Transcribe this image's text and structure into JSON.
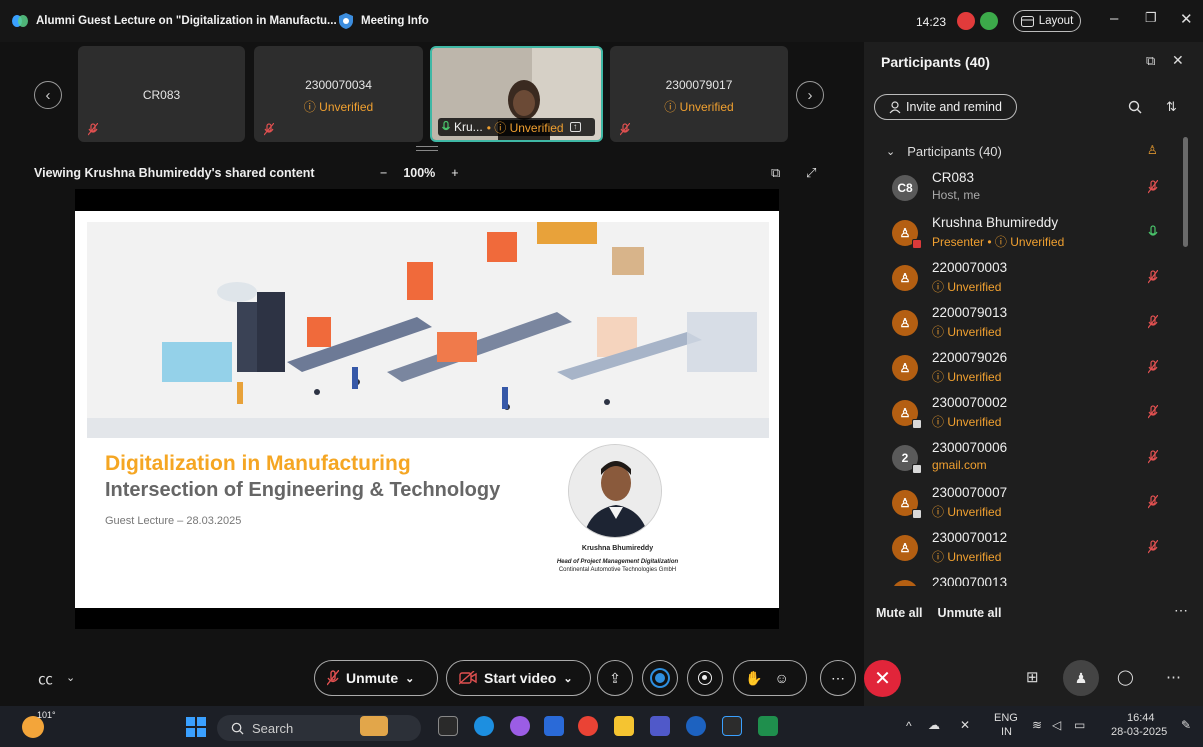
{
  "window": {
    "title": "Alumni Guest Lecture on \"Digitalization in Manufactu...",
    "meeting_info": "Meeting Info",
    "clock": "14:23",
    "layout_label": "Layout"
  },
  "strip": {
    "tiles": [
      {
        "name": "CR083",
        "status": ""
      },
      {
        "name": "2300070034",
        "status": "Unverified"
      },
      {
        "name": "Kru...",
        "status": "Unverified"
      },
      {
        "name": "2300079017",
        "status": "Unverified"
      }
    ]
  },
  "share": {
    "viewing_label": "Viewing Krushna Bhumireddy's shared content",
    "zoom_minus": "−",
    "zoom_level": "100%",
    "zoom_plus": "+"
  },
  "slide": {
    "title": "Digitalization in Manufacturing",
    "subtitle": "Intersection of Engineering & Technology",
    "date_line": "Guest Lecture – 28.03.2025",
    "presenter_name": "Krushna Bhumireddy",
    "presenter_role": "Head of Project Management Digitalization",
    "presenter_company": "Continental Automotive Technologies GmbH"
  },
  "panel": {
    "title": "Participants (40)",
    "invite_label": "Invite and remind",
    "group_label": "Participants (40)",
    "participants": [
      {
        "initials": "C8",
        "name": "CR083",
        "status": "Host, me"
      },
      {
        "initials": "",
        "name": "Krushna Bhumireddy",
        "status": "Presenter • ⓘ Unverified"
      },
      {
        "initials": "",
        "name": "2200070003",
        "status": "Unverified"
      },
      {
        "initials": "",
        "name": "2200079013",
        "status": "Unverified"
      },
      {
        "initials": "",
        "name": "2200079026",
        "status": "Unverified"
      },
      {
        "initials": "",
        "name": "2300070002",
        "status": "Unverified"
      },
      {
        "initials": "2",
        "name": "2300070006",
        "status": "gmail.com"
      },
      {
        "initials": "",
        "name": "2300070007",
        "status": "Unverified"
      },
      {
        "initials": "",
        "name": "2300070012",
        "status": "Unverified"
      },
      {
        "initials": "",
        "name": "2300070013",
        "status": ""
      }
    ],
    "mute_all": "Mute all",
    "unmute_all": "Unmute all"
  },
  "toolbar": {
    "unmute_label": "Unmute",
    "start_video_label": "Start video"
  },
  "taskbar": {
    "weather": "101°",
    "search_placeholder": "Search",
    "lang_top": "ENG",
    "lang_bottom": "IN",
    "time": "16:44",
    "date": "28-03-2025"
  },
  "colors": {
    "unverified": "#f0a030",
    "accent_teal": "#3fb8a5",
    "end_call": "#e1253a",
    "avatar_orange": "#b45f12",
    "muted_red": "#e05050"
  }
}
